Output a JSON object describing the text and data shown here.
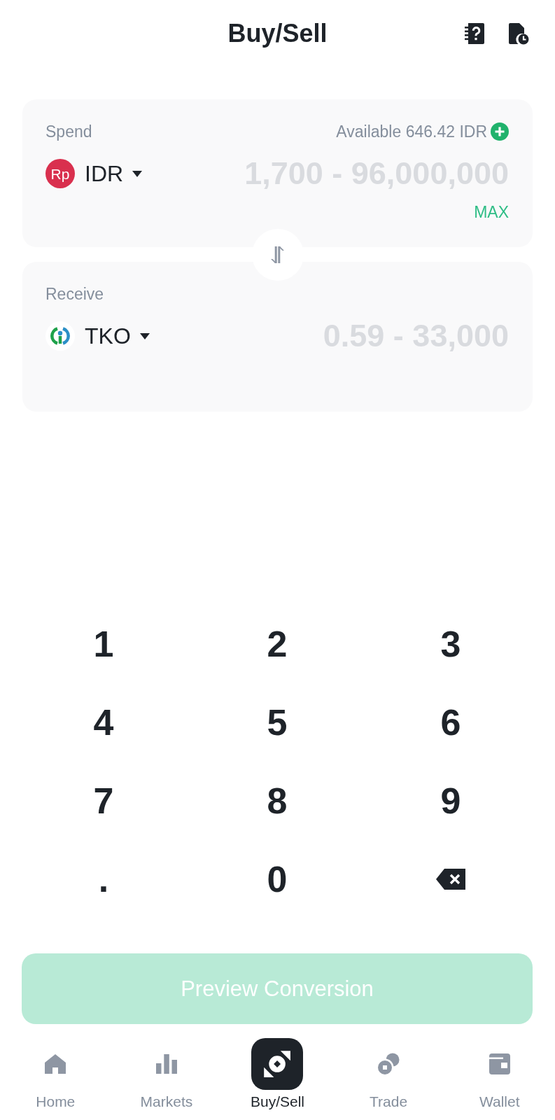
{
  "header": {
    "title": "Buy/Sell"
  },
  "spend": {
    "label": "Spend",
    "available": "Available 646.42 IDR",
    "currency": {
      "logo_text": "Rp",
      "code": "IDR"
    },
    "amount": {
      "placeholder": "1,700 - 96,000,000"
    },
    "max": "MAX"
  },
  "receive": {
    "label": "Receive",
    "currency": {
      "code": "TKO"
    },
    "amount": {
      "placeholder": "0.59 - 33,000"
    }
  },
  "keypad": [
    {
      "kind": "digit",
      "label": "1"
    },
    {
      "kind": "digit",
      "label": "2"
    },
    {
      "kind": "digit",
      "label": "3"
    },
    {
      "kind": "digit",
      "label": "4"
    },
    {
      "kind": "digit",
      "label": "5"
    },
    {
      "kind": "digit",
      "label": "6"
    },
    {
      "kind": "digit",
      "label": "7"
    },
    {
      "kind": "digit",
      "label": "8"
    },
    {
      "kind": "digit",
      "label": "9"
    },
    {
      "kind": "decimal",
      "label": "."
    },
    {
      "kind": "digit",
      "label": "0"
    },
    {
      "kind": "backspace"
    }
  ],
  "preview_button": {
    "label": "Preview Conversion",
    "disabled": true
  },
  "nav": [
    {
      "label": "Home",
      "selected": false
    },
    {
      "label": "Markets",
      "selected": false
    },
    {
      "label": "Buy/Sell",
      "selected": true
    },
    {
      "label": "Trade",
      "selected": false
    },
    {
      "label": "Wallet",
      "selected": false
    }
  ]
}
